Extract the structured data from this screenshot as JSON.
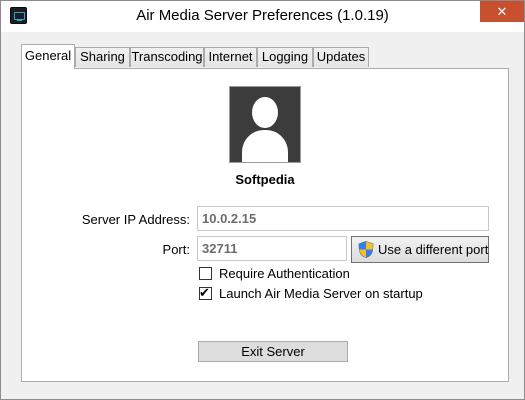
{
  "window": {
    "title": "Air Media Server Preferences (1.0.19)",
    "close_glyph": "✕",
    "app_icon": "monitor-app-icon",
    "close_color": "#c7502f"
  },
  "tabs": [
    {
      "label": "General",
      "active": true
    },
    {
      "label": "Sharing",
      "active": false
    },
    {
      "label": "Transcoding",
      "active": false
    },
    {
      "label": "Internet",
      "active": false
    },
    {
      "label": "Logging",
      "active": false
    },
    {
      "label": "Updates",
      "active": false
    }
  ],
  "general": {
    "avatar_icon": "user-silhouette-icon",
    "user_name": "Softpedia",
    "server_ip_label": "Server IP Address:",
    "server_ip_value": "10.0.2.15",
    "port_label": "Port:",
    "port_value": "32711",
    "port_button_label": "Use a different port",
    "port_button_icon": "uac-shield-icon",
    "require_auth_label": "Require Authentication",
    "require_auth_checked": false,
    "launch_on_startup_label": "Launch Air Media Server on startup",
    "launch_on_startup_checked": true,
    "exit_button_label": "Exit Server"
  }
}
